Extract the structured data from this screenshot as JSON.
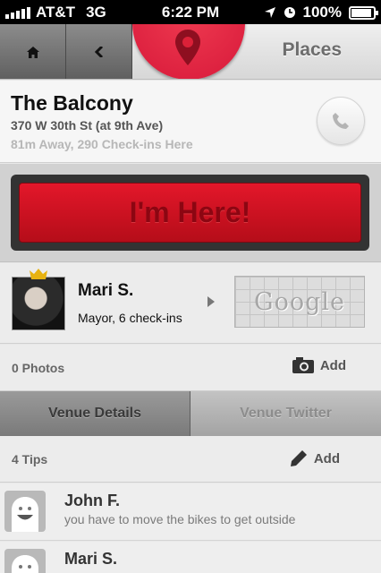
{
  "status_bar": {
    "carrier": "AT&T",
    "network": "3G",
    "time": "6:22 PM",
    "battery": "100%",
    "battery_level": 1.0
  },
  "nav": {
    "title": "Places",
    "home_icon": "home-icon",
    "back_icon": "back-chevron-icon",
    "logo_icon": "map-pin-icon"
  },
  "venue": {
    "name": "The Balcony",
    "address": "370 W 30th St (at 9th Ave)",
    "meta": "81m Away, 290 Check-ins Here",
    "call_icon": "phone-icon"
  },
  "checkin": {
    "label": "I'm Here!"
  },
  "mayor": {
    "name": "Mari S.",
    "stat": "Mayor, 6 check-ins",
    "map_label": "Google"
  },
  "photos": {
    "count": "0 Photos",
    "add_label": "Add"
  },
  "tabs": [
    {
      "label": "Venue Details",
      "active": true
    },
    {
      "label": "Venue Twitter",
      "active": false
    }
  ],
  "tips": {
    "count": "4 Tips",
    "add_label": "Add",
    "items": [
      {
        "name": "John F.",
        "text": "you have to move the bikes to get outside"
      },
      {
        "name": "Mari S.",
        "text": ""
      }
    ]
  },
  "colors": {
    "brand_red": "#e3172a",
    "checkin_text": "#8c0612",
    "crown_gold": "#e7b210"
  }
}
